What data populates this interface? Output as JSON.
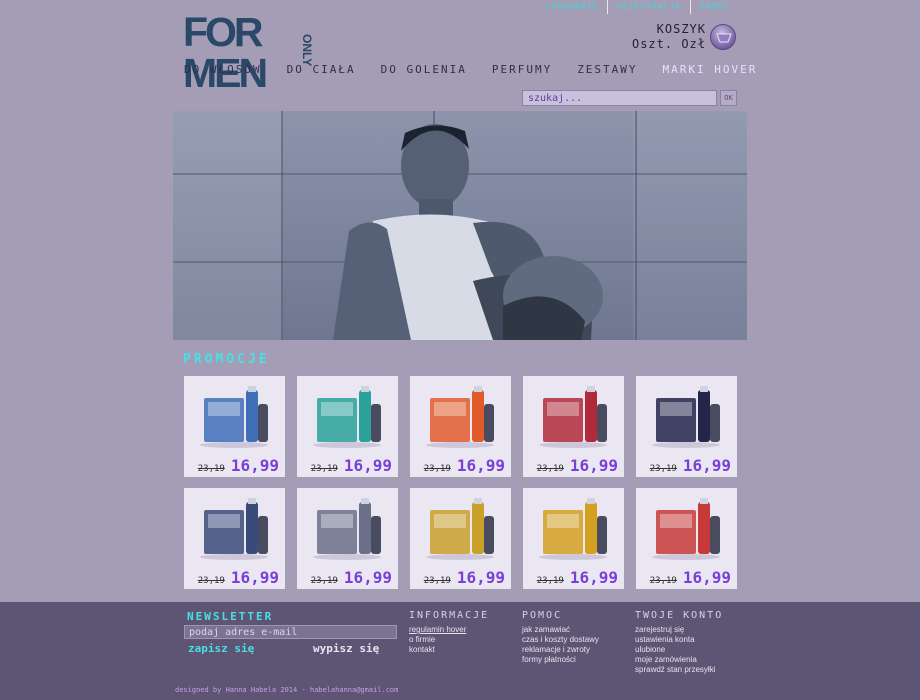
{
  "toplinks": [
    "LOGOWANIE",
    "REJESTRACJA",
    "POMOC"
  ],
  "logo": {
    "main": "FOR MEN",
    "sub": "ONLY"
  },
  "cart": {
    "label": "KOSZYK",
    "amount": "Oszt. Ozł"
  },
  "nav": [
    "DO WŁOSÓW",
    "DO CIAŁA",
    "DO GOLENIA",
    "PERFUMY",
    "ZESTAWY",
    "MARKI HOVER"
  ],
  "search": {
    "placeholder": "szukaj...",
    "button": "OK"
  },
  "promo_title": "PROMOCJE",
  "products": [
    {
      "old": "23,19",
      "new": "16,99",
      "color": "#3f6fb8"
    },
    {
      "old": "23,19",
      "new": "16,99",
      "color": "#2aa199"
    },
    {
      "old": "23,19",
      "new": "16,99",
      "color": "#e05a2a"
    },
    {
      "old": "23,19",
      "new": "16,99",
      "color": "#b02a3a"
    },
    {
      "old": "23,19",
      "new": "16,99",
      "color": "#23254a"
    },
    {
      "old": "23,19",
      "new": "16,99",
      "color": "#3a4a7a"
    },
    {
      "old": "23,19",
      "new": "16,99",
      "color": "#6a6f8a"
    },
    {
      "old": "23,19",
      "new": "16,99",
      "color": "#c9a02a"
    },
    {
      "old": "23,19",
      "new": "16,99",
      "color": "#d4a020"
    },
    {
      "old": "23,19",
      "new": "16,99",
      "color": "#c83a3a"
    }
  ],
  "newsletter": {
    "title": "NEWSLETTER",
    "placeholder": "podaj adres e-mail",
    "subscribe": "zapisz się",
    "unsubscribe": "wypisz się"
  },
  "footer_cols": [
    {
      "title": "INFORMACJE",
      "links": [
        "regulamin hover",
        "o firmie",
        "kontakt"
      ]
    },
    {
      "title": "POMOC",
      "links": [
        "jak zamawiać",
        "czas i koszty dostawy",
        "reklamacje i zwroty",
        "formy płatności"
      ]
    },
    {
      "title": "TWOJE KONTO",
      "links": [
        "zarejestruj się",
        "ustawienia konta",
        "ulubione",
        "moje zamówienia",
        "sprawdź stan przesyłki"
      ]
    }
  ],
  "credit": "designed by Hanna Habela 2014 - habelahanna@gmail.com"
}
